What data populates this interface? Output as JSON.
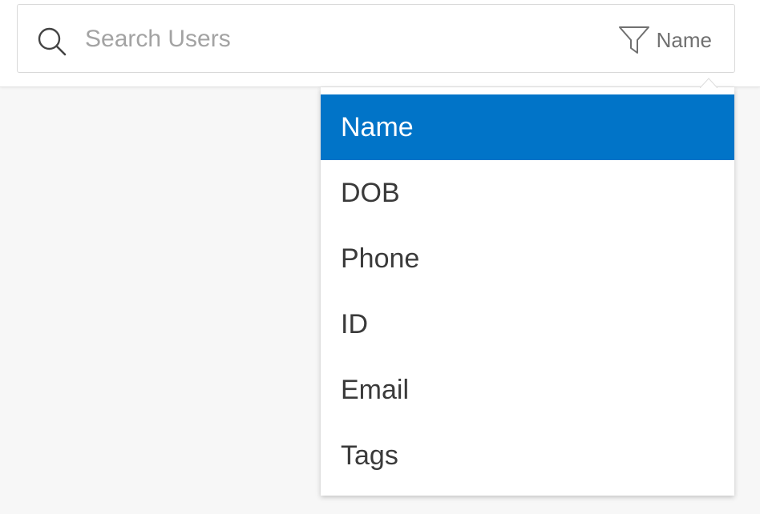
{
  "search": {
    "placeholder": "Search Users",
    "value": ""
  },
  "filter": {
    "label": "Name",
    "icon": "filter-funnel-icon"
  },
  "dropdown": {
    "selected_index": 0,
    "items": [
      {
        "label": "Name"
      },
      {
        "label": "DOB"
      },
      {
        "label": "Phone"
      },
      {
        "label": "ID"
      },
      {
        "label": "Email"
      },
      {
        "label": "Tags"
      }
    ]
  },
  "colors": {
    "accent": "#0174c8",
    "page_background": "#f7f7f7",
    "placeholder_text": "#a3a3a3",
    "menu_text": "#3a3a3a"
  }
}
